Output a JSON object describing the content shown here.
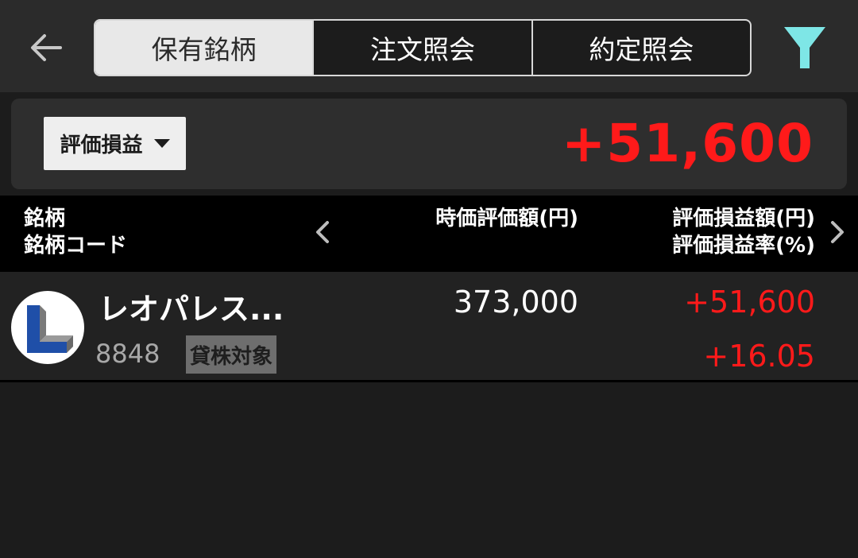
{
  "tabs": [
    {
      "label": "保有銘柄",
      "active": true
    },
    {
      "label": "注文照会",
      "active": false
    },
    {
      "label": "約定照会",
      "active": false
    }
  ],
  "icons": {
    "back": "arrow-left-icon",
    "filter": "filter-icon",
    "filter_color": "#7ee6e6"
  },
  "summary": {
    "select_label": "評価損益",
    "value": "+51,600"
  },
  "columns": {
    "left_line1": "銘柄",
    "left_line2": "銘柄コード",
    "mid": "時価評価額(円)",
    "right_line1": "評価損益額(円)",
    "right_line2": "評価損益率(%)"
  },
  "holdings": [
    {
      "name": "レオパレス...",
      "code": "8848",
      "badge": "貸株対象",
      "market_value": "373,000",
      "pl_amount": "+51,600",
      "pl_rate": "+16.05"
    }
  ],
  "colors": {
    "positive": "#ff1a1a",
    "accent": "#7ee6e6"
  }
}
